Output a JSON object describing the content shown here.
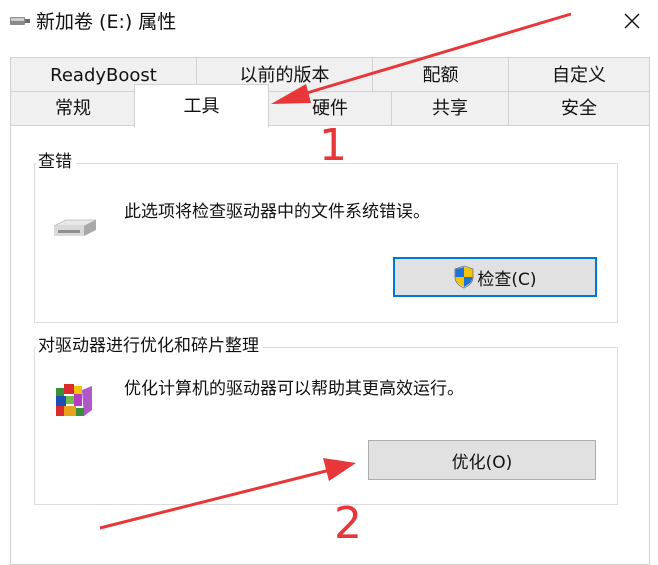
{
  "window": {
    "title": "新加卷 (E:) 属性",
    "close_icon": "close-icon",
    "drive_icon": "usb-drive-icon"
  },
  "tabs": {
    "row1": [
      {
        "label": "ReadyBoost"
      },
      {
        "label": "以前的版本"
      },
      {
        "label": "配额"
      },
      {
        "label": "自定义"
      }
    ],
    "row2": [
      {
        "label": "常规"
      },
      {
        "label": "工具",
        "selected": true
      },
      {
        "label": "硬件"
      },
      {
        "label": "共享"
      },
      {
        "label": "安全"
      }
    ]
  },
  "error_checking": {
    "title": "查错",
    "description": "此选项将检查驱动器中的文件系统错误。",
    "button_label": "检查(C)",
    "icon": "hard-drive-icon",
    "button_icon": "uac-shield-icon"
  },
  "optimize": {
    "title": "对驱动器进行优化和碎片整理",
    "description": "优化计算机的驱动器可以帮助其更高效运行。",
    "button_label": "优化(O)",
    "icon": "defrag-icon"
  },
  "annotations": {
    "label_1": "1",
    "label_2": "2",
    "color": "#e8373a"
  }
}
